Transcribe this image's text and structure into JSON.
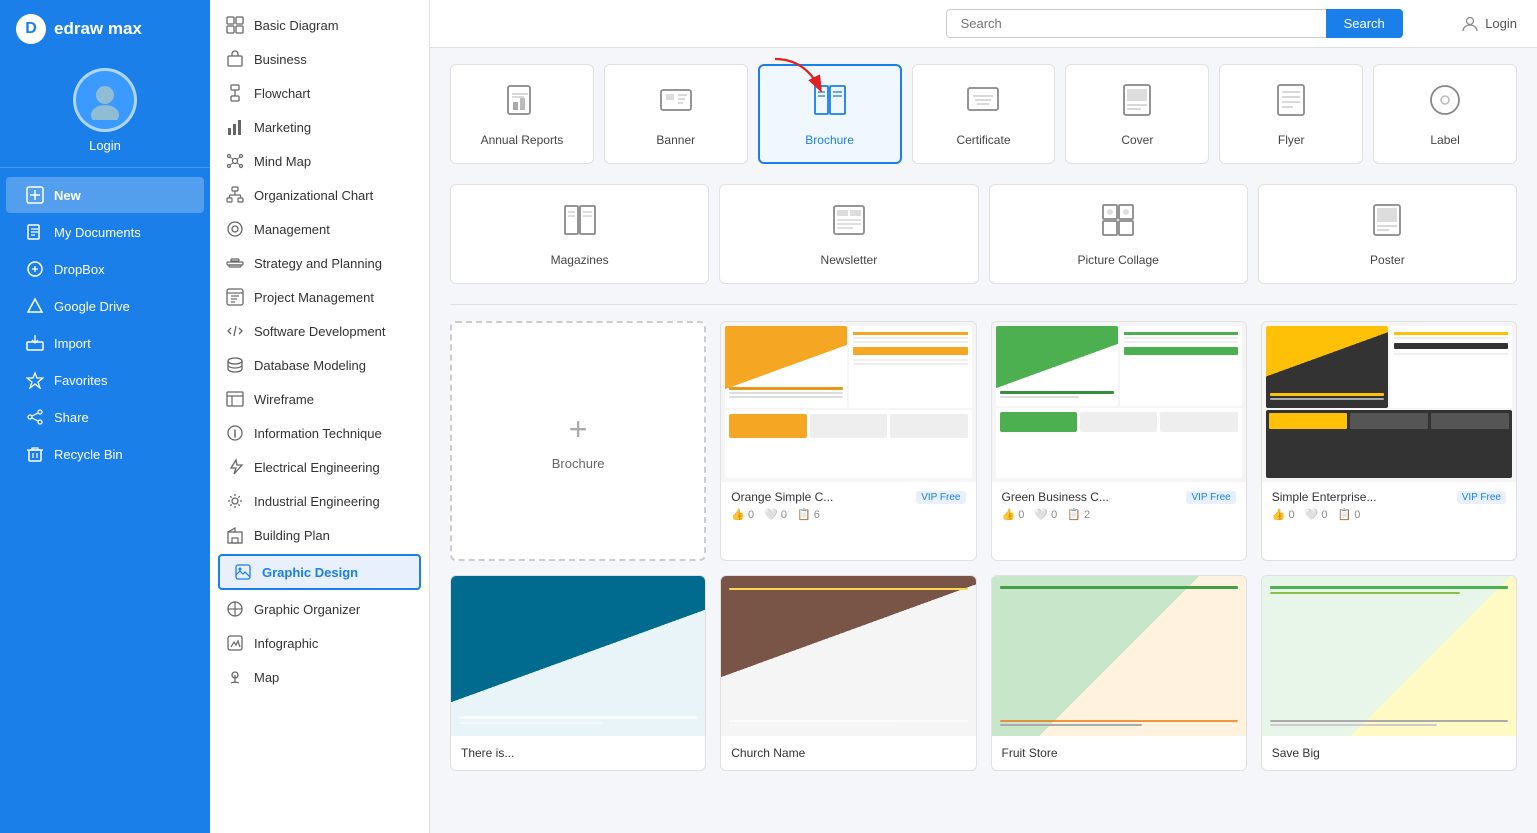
{
  "app": {
    "logo_letter": "D",
    "logo_name": "edraw max",
    "login_label": "Login"
  },
  "sidebar_nav": [
    {
      "id": "new",
      "label": "New",
      "icon": "plus-square",
      "active": true
    },
    {
      "id": "my-documents",
      "label": "My Documents",
      "icon": "file"
    },
    {
      "id": "dropbox",
      "label": "DropBox",
      "icon": "settings"
    },
    {
      "id": "google-drive",
      "label": "Google Drive",
      "icon": "triangle"
    },
    {
      "id": "import",
      "label": "Import",
      "icon": "login"
    },
    {
      "id": "favorites",
      "label": "Favorites",
      "icon": "star"
    },
    {
      "id": "share",
      "label": "Share",
      "icon": "share"
    },
    {
      "id": "recycle-bin",
      "label": "Recycle Bin",
      "icon": "trash"
    }
  ],
  "middle_nav": [
    {
      "label": "Basic Diagram",
      "icon": "grid"
    },
    {
      "label": "Business",
      "icon": "briefcase"
    },
    {
      "label": "Flowchart",
      "icon": "flow"
    },
    {
      "label": "Marketing",
      "icon": "bar-chart"
    },
    {
      "label": "Mind Map",
      "icon": "mind"
    },
    {
      "label": "Organizational Chart",
      "icon": "org"
    },
    {
      "label": "Management",
      "icon": "manage"
    },
    {
      "label": "Strategy and Planning",
      "icon": "strategy"
    },
    {
      "label": "Project Management",
      "icon": "project"
    },
    {
      "label": "Software Development",
      "icon": "software"
    },
    {
      "label": "Database Modeling",
      "icon": "database"
    },
    {
      "label": "Wireframe",
      "icon": "wireframe"
    },
    {
      "label": "Information Technique",
      "icon": "info"
    },
    {
      "label": "Electrical Engineering",
      "icon": "electrical"
    },
    {
      "label": "Industrial Engineering",
      "icon": "industrial"
    },
    {
      "label": "Building Plan",
      "icon": "building"
    },
    {
      "label": "Graphic Design",
      "icon": "graphic",
      "active": true
    },
    {
      "label": "Graphic Organizer",
      "icon": "organizer"
    },
    {
      "label": "Infographic",
      "icon": "infographic"
    },
    {
      "label": "Map",
      "icon": "map"
    }
  ],
  "header": {
    "search_placeholder": "Search",
    "search_button": "Search",
    "login_label": "Login"
  },
  "categories_row1": [
    {
      "id": "annual-reports",
      "label": "Annual Reports",
      "icon": "📊",
      "selected": false
    },
    {
      "id": "banner",
      "label": "Banner",
      "icon": "🖼️",
      "selected": false
    },
    {
      "id": "brochure",
      "label": "Brochure",
      "icon": "📄",
      "selected": true
    },
    {
      "id": "certificate",
      "label": "Certificate",
      "icon": "📜",
      "selected": false
    },
    {
      "id": "cover",
      "label": "Cover",
      "icon": "📰",
      "selected": false
    },
    {
      "id": "flyer",
      "label": "Flyer",
      "icon": "📋",
      "selected": false
    },
    {
      "id": "label",
      "label": "Label",
      "icon": "🏷️",
      "selected": false
    }
  ],
  "categories_row2": [
    {
      "id": "magazines",
      "label": "Magazines",
      "icon": "📖",
      "selected": false
    },
    {
      "id": "newsletter",
      "label": "Newsletter",
      "icon": "📰",
      "selected": false
    },
    {
      "id": "picture-collage",
      "label": "Picture Collage",
      "icon": "🖼️",
      "selected": false
    },
    {
      "id": "poster",
      "label": "Poster",
      "icon": "📌",
      "selected": false
    }
  ],
  "new_template_label": "Brochure",
  "templates": [
    {
      "id": "orange-simple",
      "title": "Orange Simple C...",
      "badge": "VIP Free",
      "likes": 0,
      "hearts": 0,
      "copies": 6,
      "color": "orange"
    },
    {
      "id": "green-business",
      "title": "Green Business C...",
      "badge": "VIP Free",
      "likes": 0,
      "hearts": 0,
      "copies": 2,
      "color": "green"
    },
    {
      "id": "simple-enterprise",
      "title": "Simple Enterprise...",
      "badge": "VIP Free",
      "likes": 0,
      "hearts": 0,
      "copies": 0,
      "color": "yellow"
    }
  ],
  "templates_row2": [
    {
      "id": "teal",
      "title": "There is...",
      "color": "teal"
    },
    {
      "id": "church",
      "title": "Church Name",
      "color": "church"
    },
    {
      "id": "fruit",
      "title": "Fruit Store",
      "color": "fruit"
    },
    {
      "id": "save-big",
      "title": "Save Big",
      "color": "savebig"
    }
  ]
}
